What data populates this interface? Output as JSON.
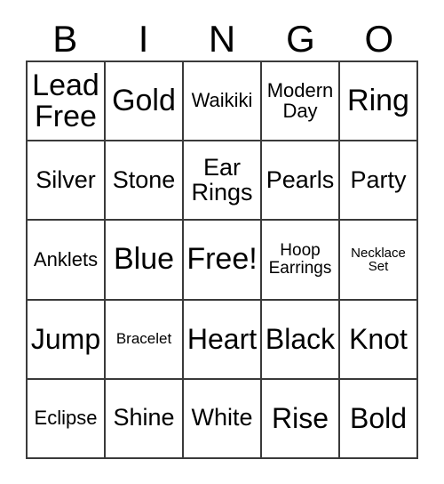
{
  "card": {
    "title": "BINGO",
    "header_letters": [
      "B",
      "I",
      "N",
      "G",
      "O"
    ],
    "grid": {
      "rows": 5,
      "columns": 5,
      "border_color": "#3a3a3a",
      "background_color": "#ffffff",
      "text_color": "#000000",
      "free_space": "Free!",
      "cells": [
        [
          {
            "label": "Lead\nFree",
            "size": "xl"
          },
          {
            "label": "Gold",
            "size": "xl"
          },
          {
            "label": "Waikiki",
            "size": "sm"
          },
          {
            "label": "Modern\nDay",
            "size": "sm"
          },
          {
            "label": "Ring",
            "size": "xl"
          }
        ],
        [
          {
            "label": "Silver",
            "size": "md"
          },
          {
            "label": "Stone",
            "size": "md"
          },
          {
            "label": "Ear\nRings",
            "size": "md"
          },
          {
            "label": "Pearls",
            "size": "md"
          },
          {
            "label": "Party",
            "size": "md"
          }
        ],
        [
          {
            "label": "Anklets",
            "size": "sm"
          },
          {
            "label": "Blue",
            "size": "xl"
          },
          {
            "label": "Free!",
            "size": "xl"
          },
          {
            "label": "Hoop\nEarrings",
            "size": "xs"
          },
          {
            "label": "Necklace\nSet",
            "size": "tiny"
          }
        ],
        [
          {
            "label": "Jump",
            "size": "lg"
          },
          {
            "label": "Bracelet",
            "size": "xxs"
          },
          {
            "label": "Heart",
            "size": "lg"
          },
          {
            "label": "Black",
            "size": "lg"
          },
          {
            "label": "Knot",
            "size": "lg"
          }
        ],
        [
          {
            "label": "Eclipse",
            "size": "sm"
          },
          {
            "label": "Shine",
            "size": "md"
          },
          {
            "label": "White",
            "size": "md"
          },
          {
            "label": "Rise",
            "size": "lg"
          },
          {
            "label": "Bold",
            "size": "lg"
          }
        ]
      ]
    }
  }
}
